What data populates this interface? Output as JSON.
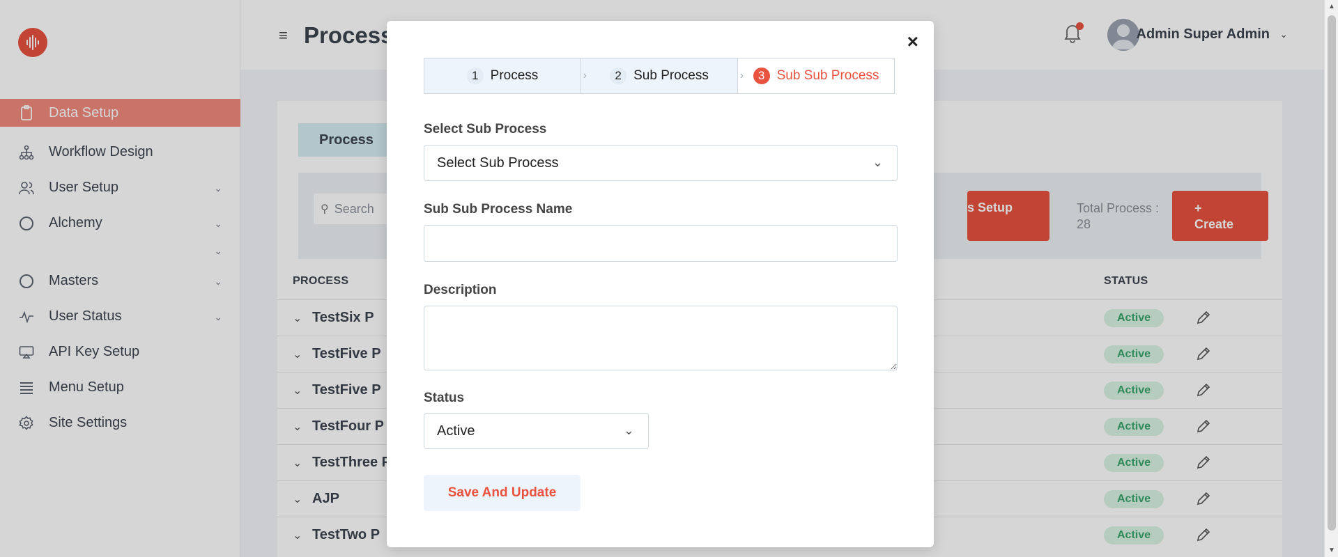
{
  "colors": {
    "accent": "#e8523f",
    "active_badge_bg": "#d8f3e4",
    "active_badge_text": "#3aa56d"
  },
  "sidebar": {
    "items": [
      {
        "label": "Data Setup",
        "icon": "clipboard-icon"
      },
      {
        "label": "Workflow Design",
        "icon": "hierarchy-icon"
      },
      {
        "label": "User Setup",
        "icon": "users-icon"
      },
      {
        "label": "Alchemy",
        "icon": "circle-icon"
      },
      {
        "label": "Masters",
        "icon": "circle-icon"
      },
      {
        "label": "User Status",
        "icon": "pulse-icon"
      },
      {
        "label": "API Key Setup",
        "icon": "airplay-icon"
      },
      {
        "label": "Menu Setup",
        "icon": "list-icon"
      },
      {
        "label": "Site Settings",
        "icon": "gear-icon"
      }
    ]
  },
  "header": {
    "title": "Process",
    "user_name": "Admin Super Admin"
  },
  "main": {
    "tab_label": "Process",
    "search_placeholder": "Search",
    "setup_button": "s Setup",
    "total_label": "Total Process :",
    "total_value": "28",
    "create_plus": "+",
    "create_label": "Create",
    "columns": {
      "process": "PROCESS",
      "status": "STATUS"
    },
    "rows": [
      {
        "name": "TestSix P",
        "status": "Active"
      },
      {
        "name": "TestFive P",
        "status": "Active"
      },
      {
        "name": "TestFive P",
        "status": "Active"
      },
      {
        "name": "TestFour P",
        "status": "Active"
      },
      {
        "name": "TestThree P",
        "status": "Active"
      },
      {
        "name": "AJP",
        "status": "Active"
      },
      {
        "name": "TestTwo P",
        "status": "Active"
      }
    ]
  },
  "modal": {
    "close": "×",
    "steps": [
      {
        "num": "1",
        "label": "Process"
      },
      {
        "num": "2",
        "label": "Sub Process"
      },
      {
        "num": "3",
        "label": "Sub Sub Process"
      }
    ],
    "select_sub_process_label": "Select Sub Process",
    "select_sub_process_value": "Select Sub Process",
    "sub_sub_name_label": "Sub Sub Process Name",
    "sub_sub_name_value": "",
    "description_label": "Description",
    "description_value": "",
    "status_label": "Status",
    "status_value": "Active",
    "save_button": "Save And Update"
  }
}
